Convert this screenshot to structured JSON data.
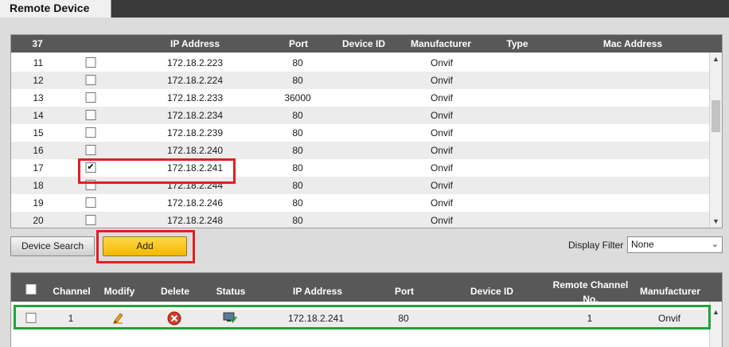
{
  "tab": {
    "title": "Remote Device"
  },
  "search_table": {
    "count": "37",
    "headers": {
      "ip": "IP Address",
      "port": "Port",
      "device_id": "Device ID",
      "manufacturer": "Manufacturer",
      "type": "Type",
      "mac": "Mac Address"
    },
    "rows": [
      {
        "no": "11",
        "ip": "172.18.2.223",
        "port": "80",
        "manufacturer": "Onvif",
        "checked": false
      },
      {
        "no": "12",
        "ip": "172.18.2.224",
        "port": "80",
        "manufacturer": "Onvif",
        "checked": false
      },
      {
        "no": "13",
        "ip": "172.18.2.233",
        "port": "36000",
        "manufacturer": "Onvif",
        "checked": false
      },
      {
        "no": "14",
        "ip": "172.18.2.234",
        "port": "80",
        "manufacturer": "Onvif",
        "checked": false
      },
      {
        "no": "15",
        "ip": "172.18.2.239",
        "port": "80",
        "manufacturer": "Onvif",
        "checked": false
      },
      {
        "no": "16",
        "ip": "172.18.2.240",
        "port": "80",
        "manufacturer": "Onvif",
        "checked": false
      },
      {
        "no": "17",
        "ip": "172.18.2.241",
        "port": "80",
        "manufacturer": "Onvif",
        "checked": true
      },
      {
        "no": "18",
        "ip": "172.18.2.244",
        "port": "80",
        "manufacturer": "Onvif",
        "checked": false
      },
      {
        "no": "19",
        "ip": "172.18.2.246",
        "port": "80",
        "manufacturer": "Onvif",
        "checked": false
      },
      {
        "no": "20",
        "ip": "172.18.2.248",
        "port": "80",
        "manufacturer": "Onvif",
        "checked": false
      }
    ]
  },
  "controls": {
    "device_search_label": "Device Search",
    "add_label": "Add",
    "display_filter_label": "Display Filter",
    "display_filter_value": "None"
  },
  "added_table": {
    "headers": {
      "channel": "Channel",
      "modify": "Modify",
      "delete": "Delete",
      "status": "Status",
      "ip": "IP Address",
      "port": "Port",
      "device_id": "Device ID",
      "remote_channel_no": "Remote Channel No.",
      "manufacturer": "Manufacturer"
    },
    "rows": [
      {
        "channel": "1",
        "ip": "172.18.2.241",
        "port": "80",
        "remote_channel_no": "1",
        "manufacturer": "Onvif"
      }
    ]
  },
  "icons": {
    "modify": "pencil-icon",
    "delete": "delete-circle-icon",
    "status": "connected-monitor-icon"
  },
  "colors": {
    "header_bg": "#585858",
    "add_button": "#f5b800",
    "highlight_red": "#e02020",
    "highlight_green": "#21a33c"
  }
}
